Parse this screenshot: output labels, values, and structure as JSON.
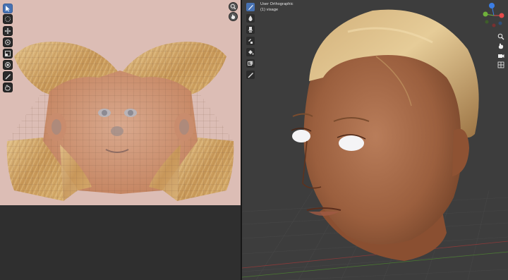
{
  "viewport": {
    "view_name": "User Orthographic",
    "object_info": "(1) visage",
    "gizmo_labels": {
      "z": "Z",
      "x": "X",
      "y": "Y"
    }
  },
  "icons": {
    "uv_tools": [
      "select-icon",
      "select-circle-icon",
      "move-icon",
      "rotate-icon",
      "scale-icon",
      "transform-icon",
      "annotate-icon",
      "grab-icon"
    ],
    "uv_nav": [
      "zoom-icon",
      "pan-icon"
    ],
    "paint_tools": [
      "brush-icon",
      "blur-icon",
      "smear-icon",
      "clone-icon",
      "fill-icon",
      "mask-icon",
      "annotate-icon"
    ],
    "view_nav": [
      "zoom-icon",
      "hand-icon",
      "camera-icon",
      "grid-icon"
    ]
  },
  "colors": {
    "active_tool": "#4772b3",
    "uv_background": "#dcbdb5",
    "viewport_background": "#3d3d3d",
    "axis_x": "#e44a4a",
    "axis_y": "#6fb13b",
    "axis_z": "#3b7de4"
  }
}
